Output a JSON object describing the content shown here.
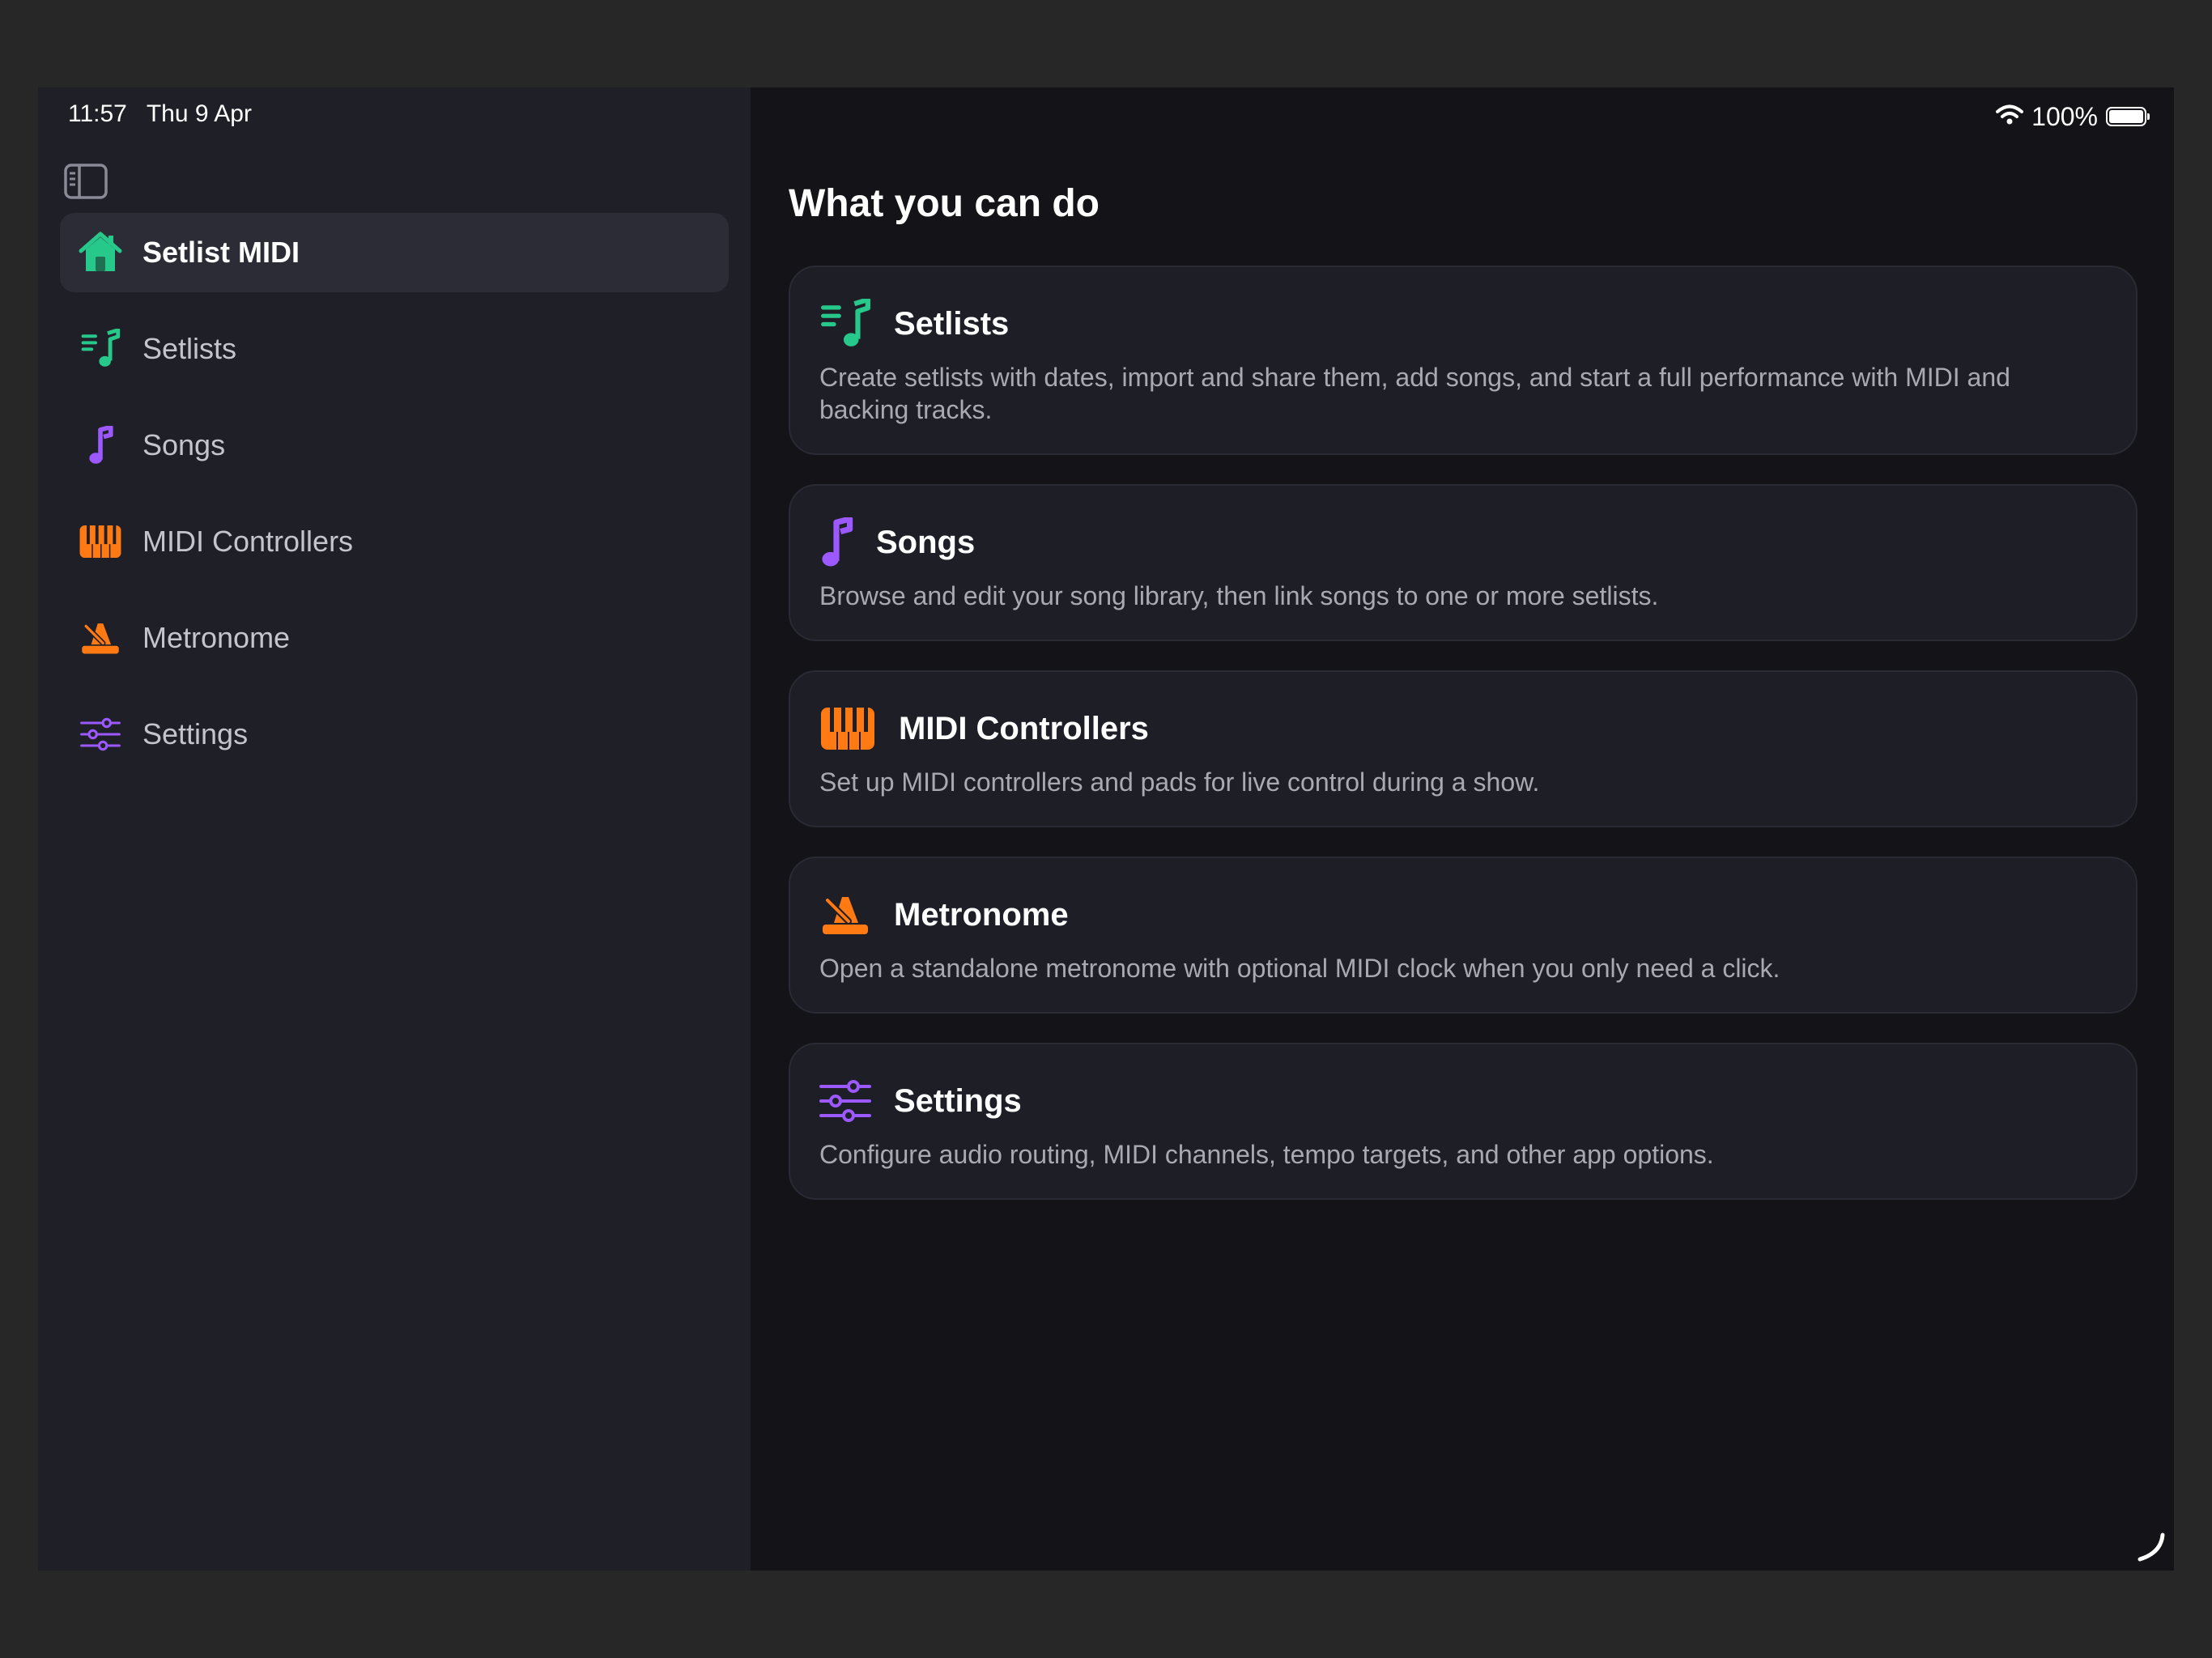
{
  "status_bar": {
    "time": "11:57",
    "date": "Thu 9 Apr",
    "battery": "100%",
    "wifi_icon": "wifi-icon"
  },
  "colors": {
    "accent_green": "#27c98b",
    "accent_purple": "#9b59ff",
    "accent_orange": "#ff7a12"
  },
  "sidebar": {
    "toggle_icon": "sidebar-toggle-icon",
    "items": [
      {
        "label": "Setlist MIDI",
        "icon": "house-icon",
        "active": true
      },
      {
        "label": "Setlists",
        "icon": "music-list-icon",
        "active": false
      },
      {
        "label": "Songs",
        "icon": "music-note-icon",
        "active": false
      },
      {
        "label": "MIDI Controllers",
        "icon": "piano-keys-icon",
        "active": false
      },
      {
        "label": "Metronome",
        "icon": "metronome-icon",
        "active": false
      },
      {
        "label": "Settings",
        "icon": "sliders-icon",
        "active": false
      }
    ]
  },
  "main": {
    "title": "What you can do",
    "cards": [
      {
        "title": "Setlists",
        "icon": "music-list-icon",
        "description": "Create setlists with dates, import and share them, add songs, and start a full performance with MIDI and backing tracks."
      },
      {
        "title": "Songs",
        "icon": "music-note-icon",
        "description": "Browse and edit your song library, then link songs to one or more setlists."
      },
      {
        "title": "MIDI Controllers",
        "icon": "piano-keys-icon",
        "description": "Set up MIDI controllers and pads for live control during a show."
      },
      {
        "title": "Metronome",
        "icon": "metronome-icon",
        "description": "Open a standalone metronome with optional MIDI clock when you only need a click."
      },
      {
        "title": "Settings",
        "icon": "sliders-icon",
        "description": "Configure audio routing, MIDI channels, tempo targets, and other app options."
      }
    ]
  }
}
